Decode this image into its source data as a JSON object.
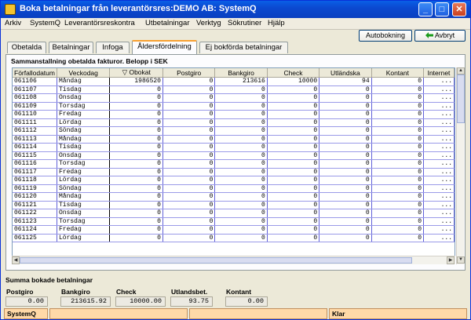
{
  "window": {
    "title": "Boka betalningar från leverantörsres:DEMO AB: SystemQ"
  },
  "menu": [
    "Arkiv",
    "SystemQ",
    "Leverantörsreskontra",
    "Utbetalningar",
    "Verktyg",
    "Sökrutiner",
    "Hjälp"
  ],
  "toolbar": {
    "autobokning": "Autobokning",
    "avbryt": "Avbryt"
  },
  "tabs": [
    "Obetalda",
    "Betalningar",
    "Infoga",
    "Åldersfördelning",
    "Ej bokförda betalningar"
  ],
  "active_tab": 3,
  "panel": {
    "title": "Sammanstallning obetalda fakturor. Belopp i SEK"
  },
  "grid": {
    "columns": [
      "Förfallodatum",
      "Veckodag",
      "▽ Obokat",
      "Postgiro",
      "Bankgiro",
      "Check",
      "Utländska",
      "Kontant",
      "Internet"
    ],
    "rows": [
      [
        "061106",
        "Måndag",
        "1986520",
        "0",
        "213616",
        "10000",
        "94",
        "0",
        "..."
      ],
      [
        "061107",
        "Tisdag",
        "0",
        "0",
        "0",
        "0",
        "0",
        "0",
        "..."
      ],
      [
        "061108",
        "Onsdag",
        "0",
        "0",
        "0",
        "0",
        "0",
        "0",
        "..."
      ],
      [
        "061109",
        "Torsdag",
        "0",
        "0",
        "0",
        "0",
        "0",
        "0",
        "..."
      ],
      [
        "061110",
        "Fredag",
        "0",
        "0",
        "0",
        "0",
        "0",
        "0",
        "..."
      ],
      [
        "061111",
        "Lördag",
        "0",
        "0",
        "0",
        "0",
        "0",
        "0",
        "..."
      ],
      [
        "061112",
        "Söndag",
        "0",
        "0",
        "0",
        "0",
        "0",
        "0",
        "..."
      ],
      [
        "061113",
        "Måndag",
        "0",
        "0",
        "0",
        "0",
        "0",
        "0",
        "..."
      ],
      [
        "061114",
        "Tisdag",
        "0",
        "0",
        "0",
        "0",
        "0",
        "0",
        "..."
      ],
      [
        "061115",
        "Onsdag",
        "0",
        "0",
        "0",
        "0",
        "0",
        "0",
        "..."
      ],
      [
        "061116",
        "Torsdag",
        "0",
        "0",
        "0",
        "0",
        "0",
        "0",
        "..."
      ],
      [
        "061117",
        "Fredag",
        "0",
        "0",
        "0",
        "0",
        "0",
        "0",
        "..."
      ],
      [
        "061118",
        "Lördag",
        "0",
        "0",
        "0",
        "0",
        "0",
        "0",
        "..."
      ],
      [
        "061119",
        "Söndag",
        "0",
        "0",
        "0",
        "0",
        "0",
        "0",
        "..."
      ],
      [
        "061120",
        "Måndag",
        "0",
        "0",
        "0",
        "0",
        "0",
        "0",
        "..."
      ],
      [
        "061121",
        "Tisdag",
        "0",
        "0",
        "0",
        "0",
        "0",
        "0",
        "..."
      ],
      [
        "061122",
        "Onsdag",
        "0",
        "0",
        "0",
        "0",
        "0",
        "0",
        "..."
      ],
      [
        "061123",
        "Torsdag",
        "0",
        "0",
        "0",
        "0",
        "0",
        "0",
        "..."
      ],
      [
        "061124",
        "Fredag",
        "0",
        "0",
        "0",
        "0",
        "0",
        "0",
        "..."
      ],
      [
        "061125",
        "Lördag",
        "0",
        "0",
        "0",
        "0",
        "0",
        "0",
        "..."
      ]
    ]
  },
  "summary": {
    "title": "Summa bokade betalningar",
    "fields": [
      {
        "label": "Postgiro",
        "value": "0.00"
      },
      {
        "label": "Bankgiro",
        "value": "213615.92"
      },
      {
        "label": "Check",
        "value": "10000.00"
      },
      {
        "label": "Utlandsbet.",
        "value": "93.75"
      },
      {
        "label": "Kontant",
        "value": "0.00"
      }
    ]
  },
  "status": {
    "left": "SystemQ",
    "right": "Klar"
  },
  "colors": {
    "titlebar": "#0a4fd6",
    "tab_accent": "#f8a030",
    "grid_lines": "#6262d8",
    "statusbar": "#ffd9a8"
  }
}
